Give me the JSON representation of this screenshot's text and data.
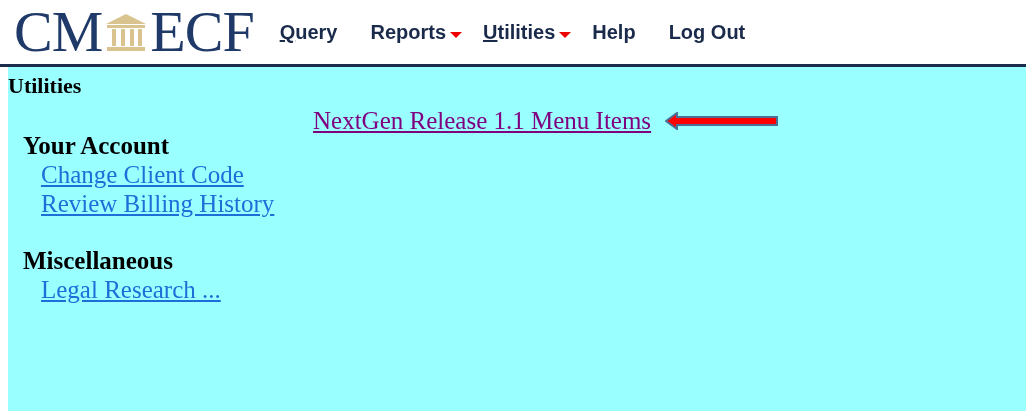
{
  "logo": {
    "left": "CM",
    "right": "ECF"
  },
  "menu": [
    {
      "hotkey": "Q",
      "rest": "uery",
      "dropdown": false
    },
    {
      "rest": "Reports",
      "dropdown": true
    },
    {
      "hotkey": "U",
      "rest": "tilities",
      "dropdown": true
    },
    {
      "rest": "Help",
      "dropdown": false
    },
    {
      "rest": "Log Out",
      "dropdown": false
    }
  ],
  "page_title": "Utilities",
  "highlight_link": {
    "label": "NextGen Release 1.1 Menu Items",
    "visited": true
  },
  "sections": [
    {
      "heading": "Your Account",
      "links": [
        {
          "label": "Change Client Code",
          "visited": false
        },
        {
          "label": "Review Billing History",
          "visited": false
        }
      ]
    },
    {
      "heading": "Miscellaneous",
      "links": [
        {
          "label": "Legal Research ...",
          "visited": false
        }
      ]
    }
  ]
}
